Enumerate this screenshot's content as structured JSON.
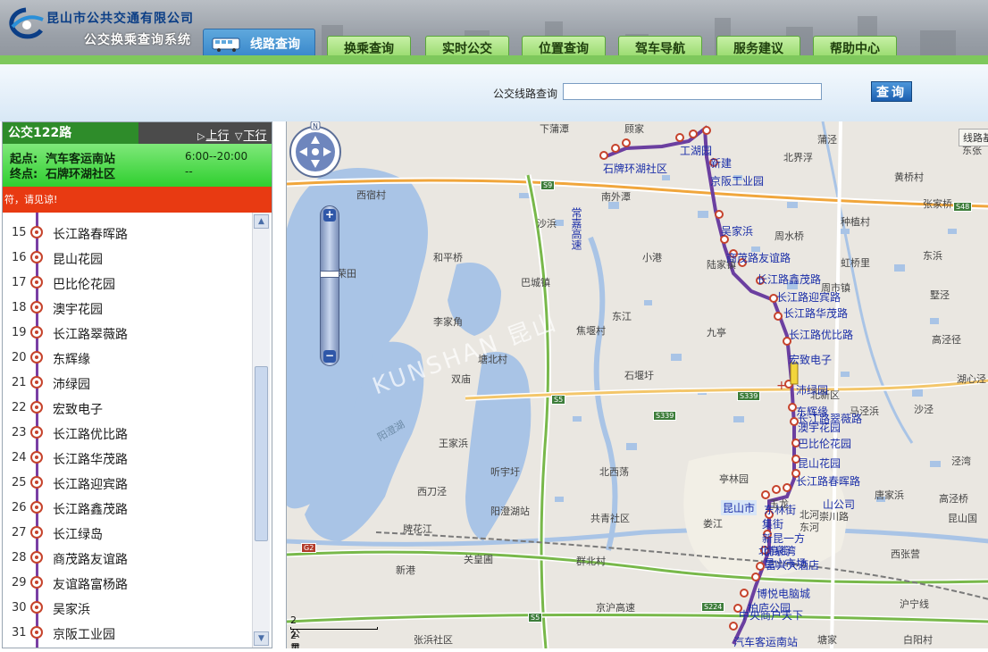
{
  "header": {
    "company": "昆山市公共交通有限公司",
    "system": "公交换乘查询系统",
    "tabs": [
      {
        "label": "线路查询",
        "active": true
      },
      {
        "label": "换乘查询"
      },
      {
        "label": "实时公交"
      },
      {
        "label": "位置查询"
      },
      {
        "label": "驾车导航"
      },
      {
        "label": "服务建议"
      },
      {
        "label": "帮助中心"
      }
    ]
  },
  "query": {
    "label": "公交线路查询",
    "value": "",
    "button": "查询"
  },
  "route": {
    "name": "公交122路",
    "dir_up": "上行",
    "dir_down": "下行",
    "start_label": "起点:",
    "start": "汽车客运南站",
    "end_label": "终点:",
    "end": "石牌环湖社区",
    "time": "6:00--20:00",
    "time2": "--",
    "notice": "符，请见谅!"
  },
  "stops": [
    {
      "num": "15",
      "name": "长江路春晖路"
    },
    {
      "num": "16",
      "name": "昆山花园"
    },
    {
      "num": "17",
      "name": "巴比伦花园"
    },
    {
      "num": "18",
      "name": "澳宇花园"
    },
    {
      "num": "19",
      "name": "长江路翠薇路"
    },
    {
      "num": "20",
      "name": "东辉缘"
    },
    {
      "num": "21",
      "name": "沛绿园"
    },
    {
      "num": "22",
      "name": "宏致电子"
    },
    {
      "num": "23",
      "name": "长江路优比路"
    },
    {
      "num": "24",
      "name": "长江路华茂路"
    },
    {
      "num": "25",
      "name": "长江路迎宾路"
    },
    {
      "num": "26",
      "name": "长江路鑫茂路"
    },
    {
      "num": "27",
      "name": "长江绿岛"
    },
    {
      "num": "28",
      "name": "商茂路友谊路"
    },
    {
      "num": "29",
      "name": "友谊路富杨路"
    },
    {
      "num": "30",
      "name": "吴家浜"
    },
    {
      "num": "31",
      "name": "京阪工业园"
    }
  ],
  "map": {
    "places": [
      "下蒲潭",
      "顾家",
      "西宿村",
      "南外潭",
      "沙浜",
      "常嘉高速",
      "和平桥",
      "巴城镇",
      "李家角",
      "小港",
      "东江",
      "焦堰村",
      "塘北村",
      "石堰圩",
      "双庙",
      "王家浜",
      "阳澄湖",
      "听宇圩",
      "北西荡",
      "西刀泾",
      "阳澄湖站",
      "共青社区",
      "新港",
      "关皇圃",
      "群北村",
      "张浜社区",
      "北界浮",
      "京阪工业园",
      "周水桥",
      "东浜",
      "周市镇",
      "蒲泾",
      "黄桥村",
      "种植村",
      "张家桥",
      "东张",
      "虹桥里",
      "高泾径",
      "墅泾",
      "泾湾",
      "马泾浜",
      "唐家浜",
      "昆山国",
      "西张营",
      "白阳村",
      "塘家",
      "亭林园",
      "昆山市",
      "陆家镇",
      "北新区",
      "九亭",
      "沪宁线",
      "娄江",
      "牌花江",
      "京沪高速",
      "新建",
      "吴家浜",
      "荣田",
      "宏致电子",
      "沛绿园",
      "石牌环湖社区",
      "工湖园",
      "湖心泾",
      "汽车客运南站",
      "中央商户天下",
      "柏庐公园",
      "博悦电脑城",
      "富兴大酒店",
      "北高街",
      "昆山市场",
      "尚泉湾",
      "新昆一方",
      "集街",
      "东林街",
      "巴比伦花园",
      "昆山花园",
      "澳宇花园",
      "长江路华茂路",
      "长江路迎宾路",
      "长江路鑫茂路",
      "长江路优比路",
      "高泾桥",
      "东辉缘",
      "长江路翠薇路",
      "长江路春晖路",
      "商茂路友谊路",
      "玉龙",
      "北河",
      "东河",
      "崇川路",
      "山公司",
      "沙泾"
    ],
    "roads": [
      "S9",
      "S5",
      "S339",
      "S339",
      "S48",
      "G2",
      "S5",
      "S224"
    ],
    "route_tag": "线路基",
    "scale_km": "2 公里",
    "scale_mi": "2 英里",
    "nav_n": "N",
    "watermark": "KUNSHAN 昆山"
  }
}
